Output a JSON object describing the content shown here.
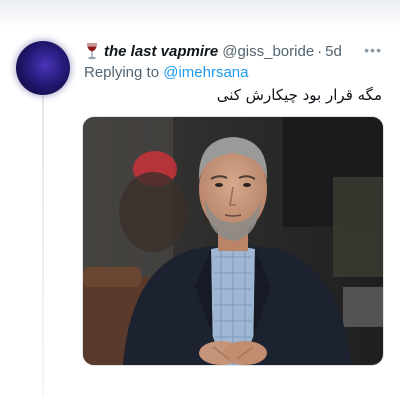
{
  "tweet": {
    "author": {
      "display_name": "the last vapmire",
      "handle": "@giss_boride",
      "name_emoji": "wine-glass-icon"
    },
    "separator": "·",
    "timestamp": "5d",
    "replying_prefix": "Replying to",
    "replying_handle": "@imehrsana",
    "text": "مگه قرار بود چیکارش کنی",
    "media": {
      "description_icon": "photo-man-in-suit"
    }
  },
  "colors": {
    "link": "#1d9bf0",
    "muted": "#536471",
    "text": "#0f1419"
  }
}
